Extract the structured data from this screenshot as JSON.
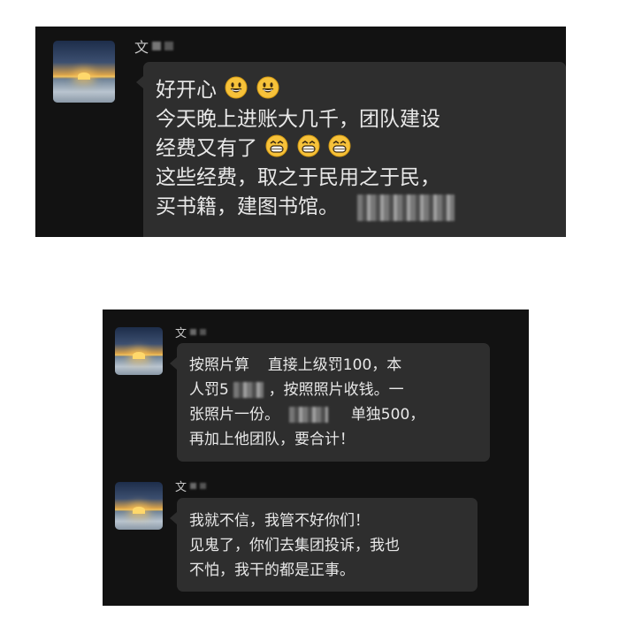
{
  "shot1": {
    "sender_initial": "文",
    "lines": {
      "l1": "好开心",
      "l2": "今天晚上进账大几千，团队建设",
      "l3": "经费又有了",
      "l4": "这些经费，取之于民用之于民，",
      "l5": "买书籍，建图书馆。"
    },
    "emoji": {
      "smile": "smiling-face-icon",
      "grin": "grinning-face-icon"
    }
  },
  "shot2": {
    "msg1": {
      "sender_initial": "文",
      "l1a": "按照片算",
      "l1b": "直接上级罚100，本",
      "l2a": "人罚5",
      "l2b": "，按照照片收钱。一",
      "l3a": "张照片一份。",
      "l3b": "单独500，",
      "l4": "再加上他团队，要合计！"
    },
    "msg2": {
      "sender_initial": "文",
      "l1": "我就不信，我管不好你们！",
      "l2": "见鬼了，你们去集团投诉，我也",
      "l3": "不怕，我干的都是正事。"
    }
  },
  "colors": {
    "background": "#121212",
    "bubble": "#2e2e2e",
    "text": "#e8e8e8"
  }
}
